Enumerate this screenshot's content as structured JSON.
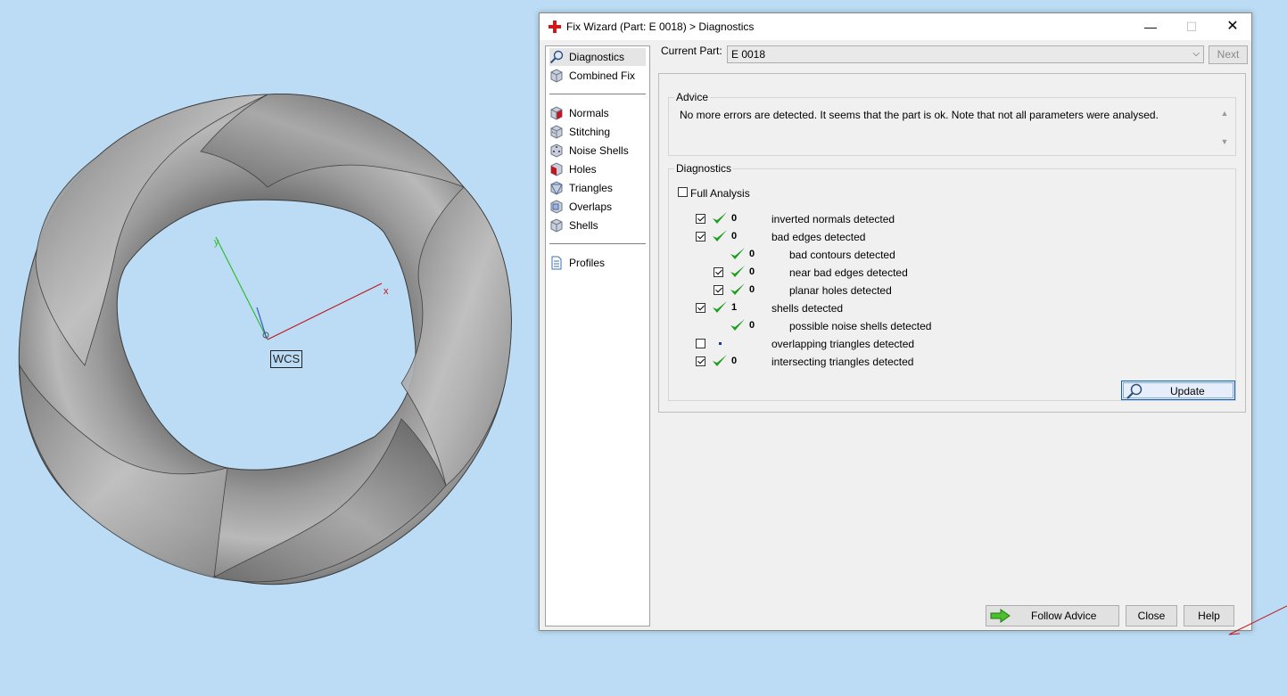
{
  "viewport": {
    "wcs_label": "WCS",
    "axis_x_label": "x",
    "axis_y_label": "y"
  },
  "window": {
    "title": "Fix Wizard (Part: E 0018) > Diagnostics",
    "minimize_glyph": "—",
    "maximize_glyph": "☐",
    "close_glyph": "✕"
  },
  "sidebar": {
    "items": [
      {
        "label": "Diagnostics",
        "icon": "magnifier-icon",
        "selected": true
      },
      {
        "label": "Combined Fix",
        "icon": "cube-icon"
      },
      {
        "label": "Normals",
        "icon": "cube-red-face-icon"
      },
      {
        "label": "Stitching",
        "icon": "cube-stitch-icon"
      },
      {
        "label": "Noise Shells",
        "icon": "cube-dots-icon"
      },
      {
        "label": "Holes",
        "icon": "cube-hole-icon"
      },
      {
        "label": "Triangles",
        "icon": "cube-triangles-icon"
      },
      {
        "label": "Overlaps",
        "icon": "cube-overlap-icon"
      },
      {
        "label": "Shells",
        "icon": "cube-shells-icon"
      },
      {
        "label": "Profiles",
        "icon": "document-icon"
      }
    ]
  },
  "header": {
    "current_part_label": "Current Part:",
    "current_part_value": "E 0018",
    "next_label": "Next"
  },
  "advice": {
    "legend": "Advice",
    "text": "No more errors are detected. It seems that the part is ok. Note that not all parameters were analysed."
  },
  "diagnostics": {
    "legend": "Diagnostics",
    "full_analysis_label": "Full Analysis",
    "full_analysis_checked": false,
    "rows": [
      {
        "checkbox": true,
        "checked": true,
        "ok": true,
        "count": "0",
        "label": "inverted normals detected",
        "indent": 0
      },
      {
        "checkbox": true,
        "checked": true,
        "ok": true,
        "count": "0",
        "label": "bad edges detected",
        "indent": 0
      },
      {
        "checkbox": false,
        "checked": false,
        "ok": true,
        "count": "0",
        "label": "bad contours detected",
        "indent": 1
      },
      {
        "checkbox": true,
        "checked": true,
        "ok": true,
        "count": "0",
        "label": "near bad edges detected",
        "indent": 1
      },
      {
        "checkbox": true,
        "checked": true,
        "ok": true,
        "count": "0",
        "label": "planar holes detected",
        "indent": 1
      },
      {
        "checkbox": true,
        "checked": true,
        "ok": true,
        "count": "1",
        "label": "shells detected",
        "indent": 0
      },
      {
        "checkbox": false,
        "checked": false,
        "ok": true,
        "count": "0",
        "label": "possible noise shells detected",
        "indent": 1
      },
      {
        "checkbox": true,
        "checked": false,
        "ok": false,
        "count": "",
        "label": "overlapping triangles detected",
        "indent": 0
      },
      {
        "checkbox": true,
        "checked": true,
        "ok": true,
        "count": "0",
        "label": "intersecting triangles detected",
        "indent": 0
      }
    ],
    "update_label": "Update"
  },
  "footer": {
    "follow_advice_label": "Follow Advice",
    "close_label": "Close",
    "help_label": "Help"
  },
  "colors": {
    "desktop_bg": "#bbdcf4",
    "ok_green": "#1e9e1e",
    "axis_x": "#c0181c",
    "axis_y": "#33bb33",
    "axis_z": "#3355cc"
  }
}
